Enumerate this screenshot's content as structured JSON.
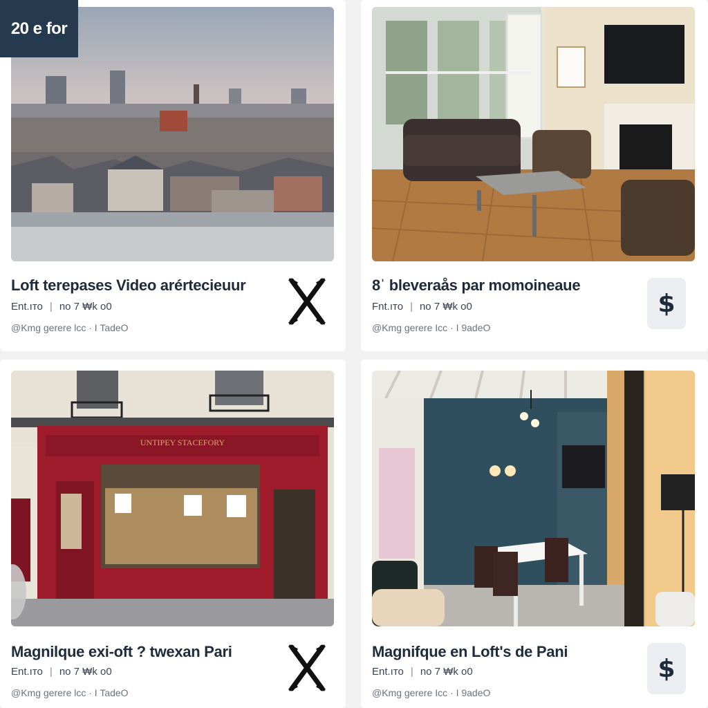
{
  "badge": {
    "label": "20 e for"
  },
  "listings": [
    {
      "title": "Loft terepases Video arértecieuur",
      "meta_left": "Ent.ıто",
      "meta_right": "no 7 ₩k o0",
      "sub": "@Kmg gerere lcc · I TadeO",
      "action": "close-icon"
    },
    {
      "title": "8ˈ bleveraås par momoineaue",
      "meta_left": "Fnt.ıто",
      "meta_right": "no 7 ₩k o0",
      "sub": "@Kmg gerere Icc · I 9adeO",
      "action": "dollar-icon",
      "action_label": "$"
    },
    {
      "title": "Magnilque exi-oft ? twexan Pari",
      "meta_left": "Ent.ıто",
      "meta_right": "no 7 ₩k o0",
      "sub": "@Kmg gerere lcc · I TadeO",
      "shop_sign": "UNTIPEY STACEFORY",
      "action": "close-icon"
    },
    {
      "title": "Magnifque en Loft's de Pani",
      "meta_left": "Ent.ıто",
      "meta_right": "no 7 ₩k o0",
      "sub": "@Kmg gerere Icc · I 9adeO",
      "action": "dollar-icon",
      "action_label": "$"
    }
  ]
}
